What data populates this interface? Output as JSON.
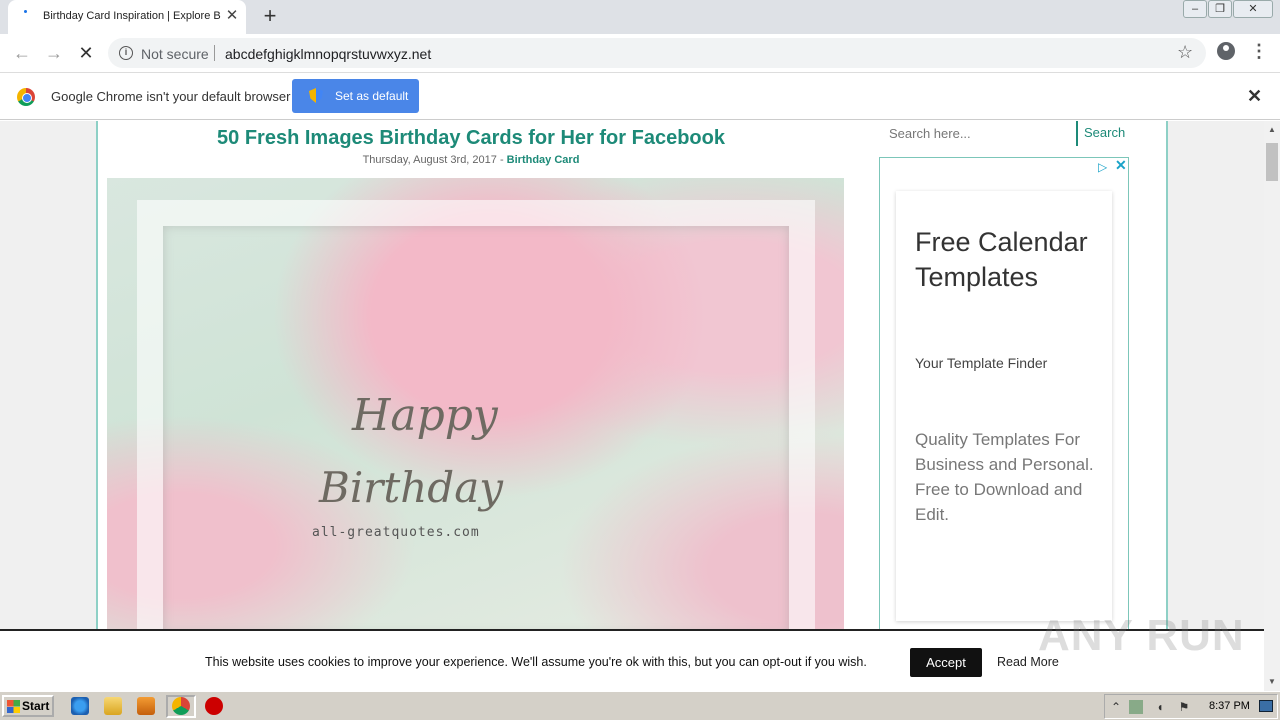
{
  "browser": {
    "tab_title": "Birthday Card Inspiration | Explore B",
    "tab_close": "✕",
    "new_tab": "+",
    "window_controls": {
      "minimize": "‒",
      "restore": "❐",
      "close": "✕"
    },
    "nav": {
      "back": "←",
      "forward": "→",
      "stop": "✕"
    },
    "security_label": "Not secure",
    "url": "abcdefghigklmnopqrstuvwxyz.net",
    "bookmark_icon": "☆",
    "menu_icon": "⋮"
  },
  "infobar": {
    "message": "Google Chrome isn't your default browser",
    "button_label": "Set as default",
    "close": "✕"
  },
  "post": {
    "title": "50 Fresh Images Birthday Cards for Her for Facebook",
    "date": "Thursday, August 3rd, 2017",
    "separator": " - ",
    "category": "Birthday Card",
    "image": {
      "line1": "Happy",
      "line2": "Birthday",
      "credit": "all-greatquotes.com"
    }
  },
  "sidebar": {
    "search_placeholder": "Search here...",
    "search_button": "Search",
    "ad": {
      "choices_icon": "▷",
      "close_icon": "✕",
      "title": "Free Calendar Templates",
      "subtitle": "Your Template Finder",
      "body": "Quality Templates For Business and Personal. Free to Download and Edit."
    }
  },
  "scrollbar": {
    "up": "▲",
    "down": "▼"
  },
  "cookie": {
    "message": "This website uses cookies to improve your experience. We'll assume you're ok with this, but you can opt-out if you wish.",
    "accept": "Accept",
    "read_more": "Read More"
  },
  "watermark": "ANY RUN",
  "taskbar": {
    "start": "Start",
    "tray_expand": "⌃",
    "clock": "8:37 PM"
  }
}
